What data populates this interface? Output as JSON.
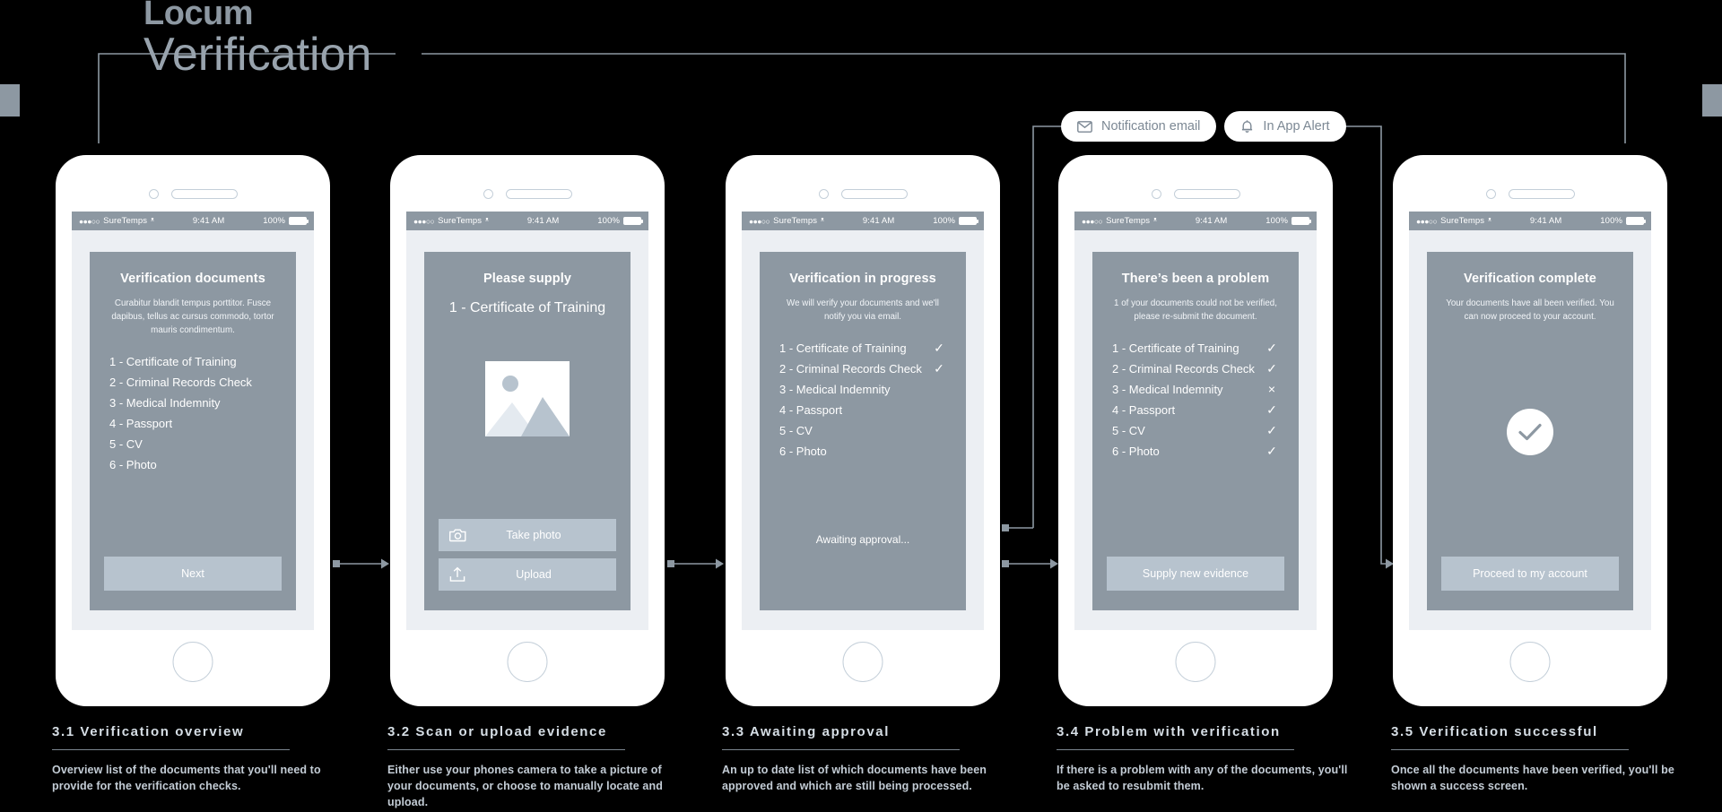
{
  "title": {
    "line1": "Locum",
    "line2": "Verification"
  },
  "notifications": [
    {
      "icon": "envelope-icon",
      "label": "Notification email"
    },
    {
      "icon": "bell-icon",
      "label": "In App Alert"
    }
  ],
  "statusbar": {
    "dots": "●●●○○",
    "carrier": "SureTemps",
    "wifi": "ᵜ",
    "time": "9:41 AM",
    "battery_pct": "100%"
  },
  "screens": [
    {
      "id": "verification-overview",
      "card_title": "Verification documents",
      "card_sub": "Curabitur blandit tempus porttitor. Fusce dapibus, tellus ac cursus commodo, tortor mauris condimentum.",
      "documents": [
        {
          "label": "1 - Certificate of Training",
          "mark": ""
        },
        {
          "label": "2 - Criminal Records Check",
          "mark": ""
        },
        {
          "label": "3 - Medical Indemnity",
          "mark": ""
        },
        {
          "label": "4 - Passport",
          "mark": ""
        },
        {
          "label": "5 - CV",
          "mark": ""
        },
        {
          "label": "6 - Photo",
          "mark": ""
        }
      ],
      "button": "Next"
    },
    {
      "id": "scan-or-upload",
      "card_title": "Please supply",
      "card_big": "1 - Certificate of Training",
      "buttons": [
        {
          "icon": "camera-icon",
          "label": "Take photo"
        },
        {
          "icon": "upload-icon",
          "label": "Upload"
        }
      ]
    },
    {
      "id": "awaiting-approval",
      "card_title": "Verification in progress",
      "card_sub": "We will verify your documents and we'll notify you via email.",
      "documents": [
        {
          "label": "1 - Certificate of Training",
          "mark": "✓"
        },
        {
          "label": "2 - Criminal Records Check",
          "mark": "✓"
        },
        {
          "label": "3 - Medical Indemnity",
          "mark": ""
        },
        {
          "label": "4 - Passport",
          "mark": ""
        },
        {
          "label": "5 - CV",
          "mark": ""
        },
        {
          "label": "6 - Photo",
          "mark": ""
        }
      ],
      "footnote": "Awaiting approval..."
    },
    {
      "id": "problem-with-verification",
      "card_title": "There’s been a problem",
      "card_sub": "1 of your documents could not be verified, please re-submit the document.",
      "documents": [
        {
          "label": "1 - Certificate of Training",
          "mark": "✓"
        },
        {
          "label": "2 - Criminal Records Check",
          "mark": "✓"
        },
        {
          "label": "3 - Medical Indemnity",
          "mark": "×"
        },
        {
          "label": "4 - Passport",
          "mark": "✓"
        },
        {
          "label": "5 - CV",
          "mark": "✓"
        },
        {
          "label": "6 - Photo",
          "mark": "✓"
        }
      ],
      "button": "Supply new evidence"
    },
    {
      "id": "verification-successful",
      "card_title": "Verification complete",
      "card_sub": "Your documents have all been verified. You can now proceed to your account.",
      "button": "Proceed to my account"
    }
  ],
  "captions": [
    {
      "title": "3.1 Verification overview",
      "body": "Overview list of the documents that you'll need to provide for the verification checks."
    },
    {
      "title": "3.2 Scan or upload evidence",
      "body": "Either use your phones camera to take a picture of your documents, or choose to manually locate and upload."
    },
    {
      "title": "3.3 Awaiting approval",
      "body": "An up to date list of which documents have been approved and which are still being processed."
    },
    {
      "title": "3.4 Problem with verification",
      "body": "If there is a problem with any of the documents, you'll be asked to resubmit them."
    },
    {
      "title": "3.5 Verification successful",
      "body": "Once all the documents have been verified, you'll be shown a success screen."
    }
  ],
  "colors": {
    "background": "#000000",
    "card": "#8d98a2",
    "card_button": "#b7c3ce",
    "screen_bg": "#eceff3",
    "phone_body": "#ffffff",
    "wire": "#8d98a2",
    "caption_title": "#d6dee5",
    "caption_body": "#c3ccd5"
  }
}
